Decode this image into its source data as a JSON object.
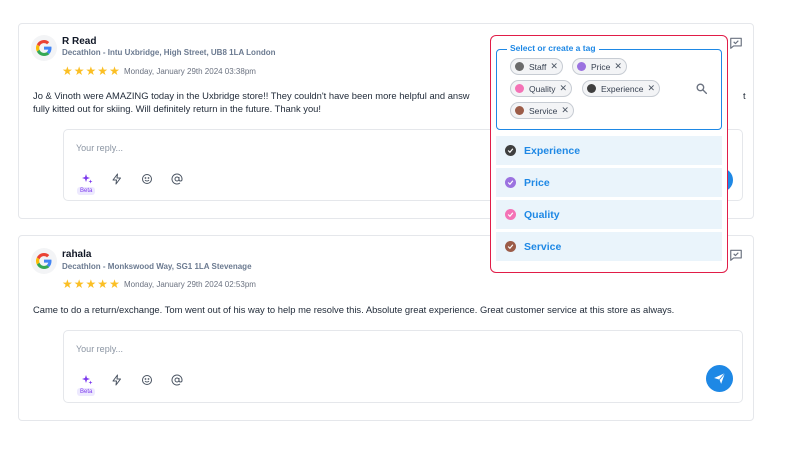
{
  "colors": {
    "accent": "#1e88e5",
    "star": "#fbbf24",
    "panel_border": "#e11d48"
  },
  "reviews": [
    {
      "reviewer": "R Read",
      "store": "Decathlon - Intu Uxbridge, High Street, UB8 1LA London",
      "rating": 5,
      "date": "Monday, January 29th 2024 03:38pm",
      "text": "Jo & Vinoth were AMAZING today in the Uxbridge store!! They couldn't have been more helpful and answ",
      "text_end": "t",
      "text_line2": "fully kitted out for skiing. Will definitely return in the future. Thank you!",
      "reply_placeholder": "Your reply...",
      "beta_label": "Beta"
    },
    {
      "reviewer": "rahala",
      "store": "Decathlon - Monkswood Way, SG1 1LA Stevenage",
      "rating": 5,
      "date": "Monday, January 29th 2024 02:53pm",
      "text": "Came to do a return/exchange. Tom went out of his way to help me resolve this. Absolute great experience. Great customer service at this store as always.",
      "reply_placeholder": "Your reply...",
      "beta_label": "Beta"
    }
  ],
  "tag_selector": {
    "legend": "Select or create a tag",
    "selected": [
      {
        "label": "Staff",
        "color": "#6b6b6b"
      },
      {
        "label": "Price",
        "color": "#9b72e0"
      },
      {
        "label": "Quality",
        "color": "#f472b6"
      },
      {
        "label": "Experience",
        "color": "#3f3f3f"
      },
      {
        "label": "Service",
        "color": "#9c5c48"
      }
    ],
    "options": [
      {
        "label": "Experience",
        "color": "#3f3f3f"
      },
      {
        "label": "Price",
        "color": "#9b72e0"
      },
      {
        "label": "Quality",
        "color": "#f472b6"
      },
      {
        "label": "Service",
        "color": "#9c5c48"
      }
    ],
    "remove_glyph": "✕"
  }
}
